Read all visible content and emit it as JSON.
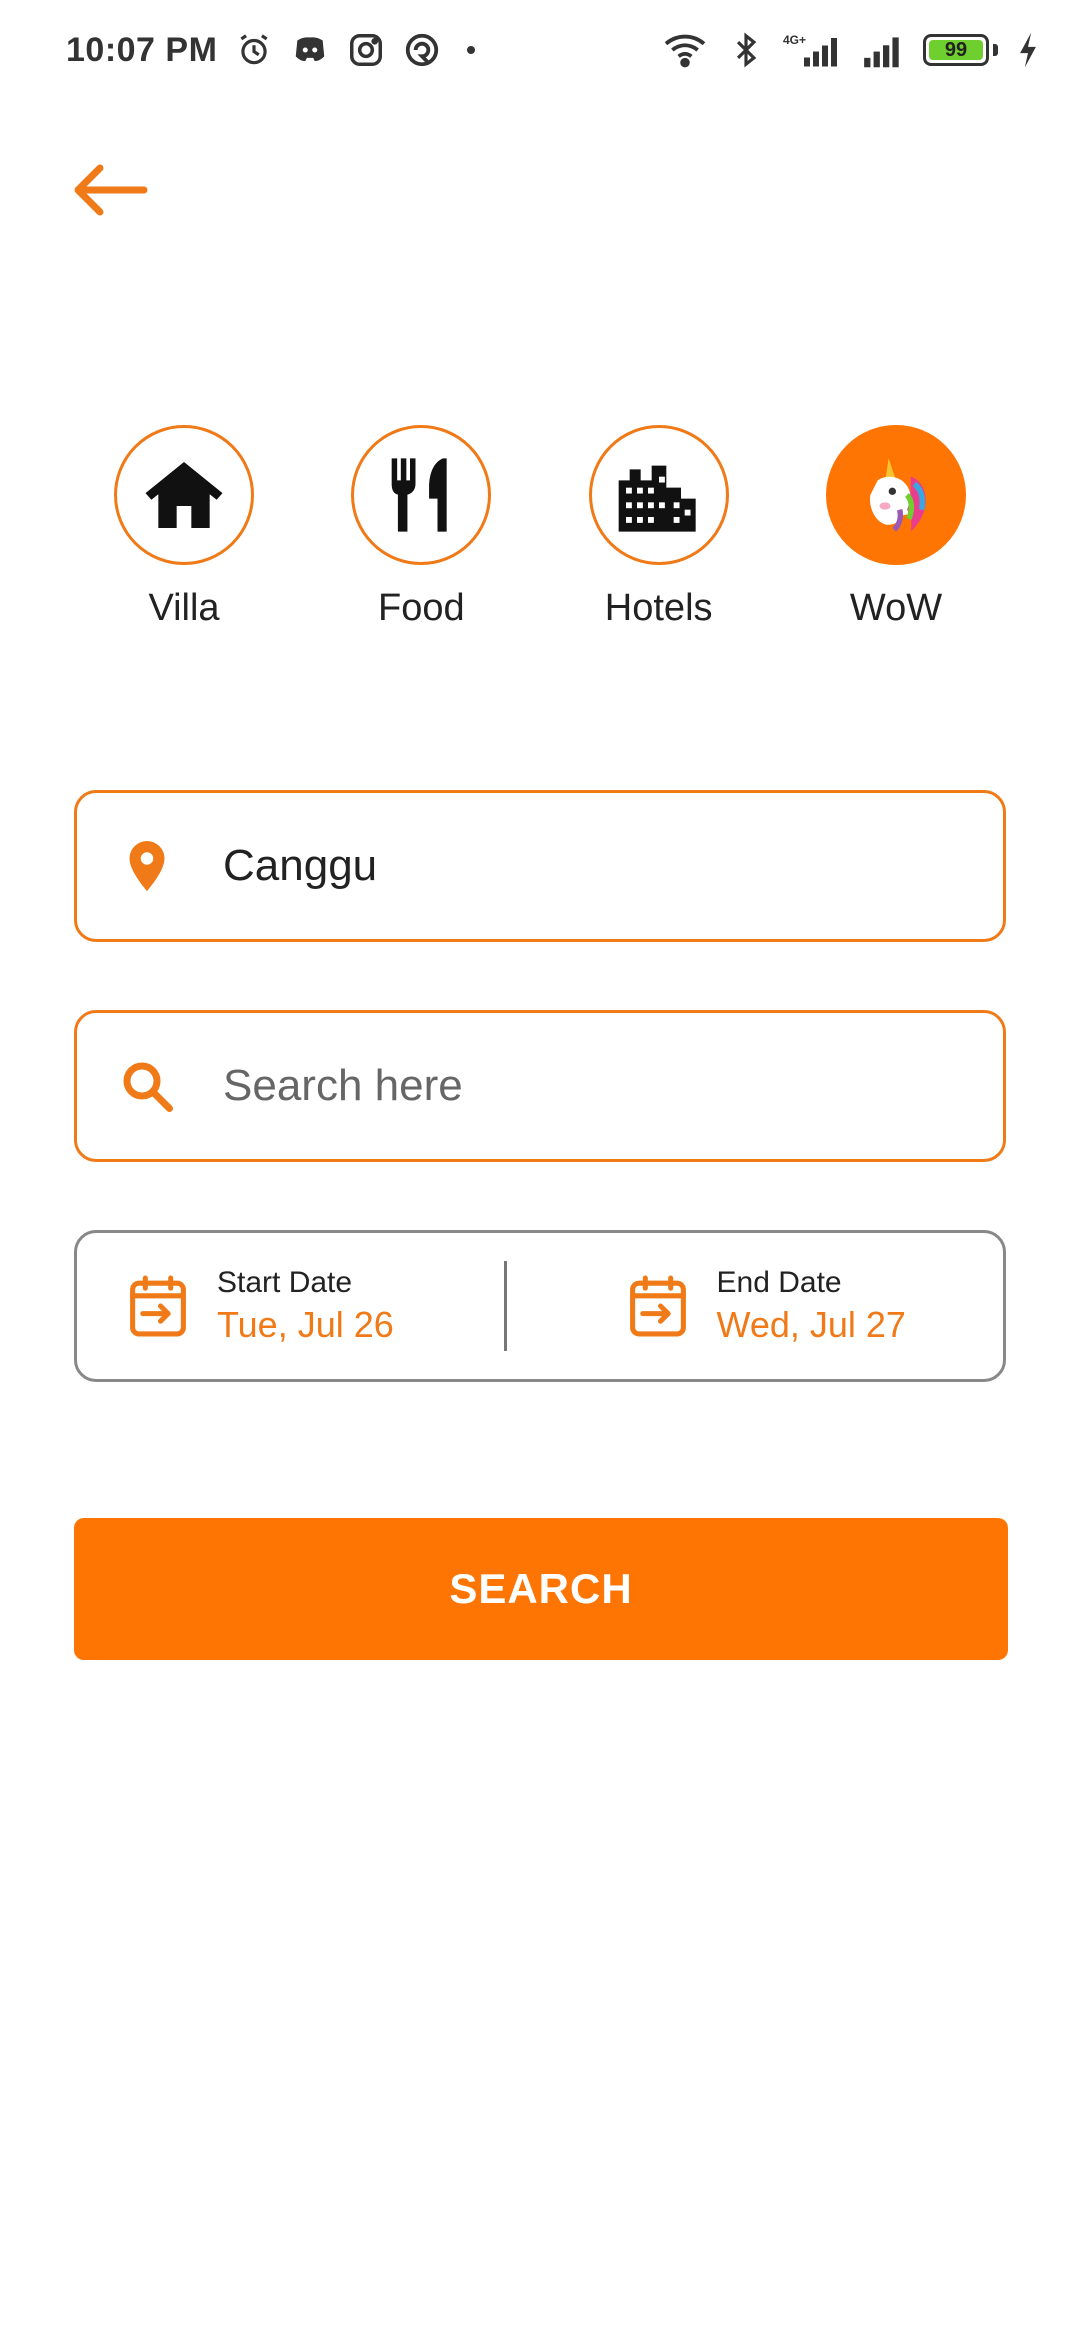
{
  "status_bar": {
    "time": "10:07 PM",
    "battery": "99",
    "network": "4G+",
    "icons": [
      "alarm-icon",
      "discord-icon",
      "instagram-icon",
      "app-icon",
      "wifi-icon",
      "bluetooth-icon",
      "signal-icon",
      "charging-icon"
    ]
  },
  "header": {
    "back_icon": "arrow-left-icon"
  },
  "categories": [
    {
      "label": "Villa",
      "icon": "house-icon"
    },
    {
      "label": "Food",
      "icon": "fork-knife-icon"
    },
    {
      "label": "Hotels",
      "icon": "building-icon"
    },
    {
      "label": "WoW",
      "icon": "unicorn-icon"
    }
  ],
  "location": {
    "value": "Canggu",
    "icon": "location-pin-icon"
  },
  "search": {
    "placeholder": "Search here",
    "icon": "search-icon"
  },
  "dates": {
    "start_label": "Start Date",
    "start_value": "Tue, Jul 26",
    "end_label": "End Date",
    "end_value": "Wed, Jul 27",
    "icon": "calendar-icon"
  },
  "search_button": {
    "label": "SEARCH"
  },
  "colors": {
    "accent": "#ef7a17",
    "button": "#ff7504",
    "battery_fill": "#6fcf2e"
  }
}
